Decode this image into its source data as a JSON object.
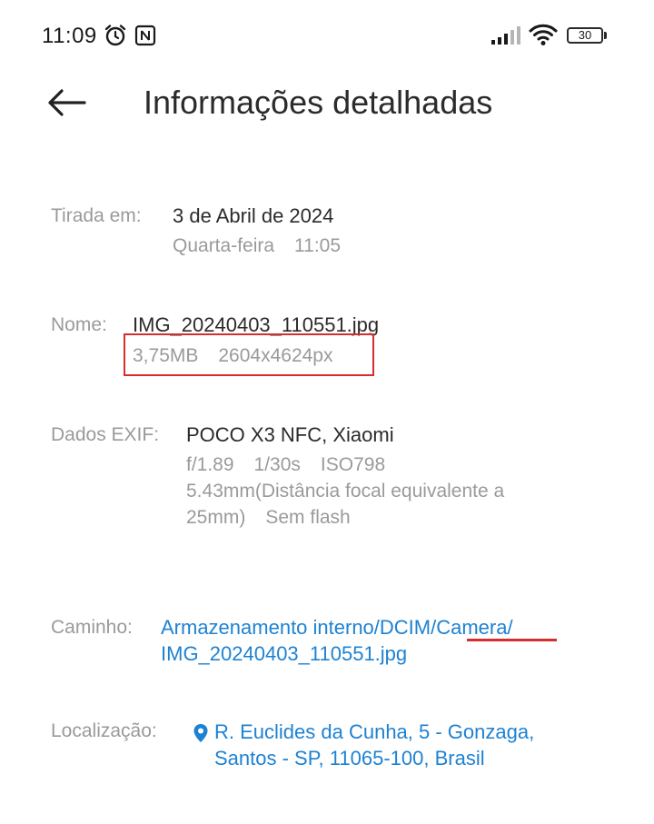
{
  "status_bar": {
    "time": "11:09",
    "battery": "30",
    "icons": [
      "alarm-icon",
      "nfc-icon",
      "signal-icon",
      "wifi-icon",
      "battery-icon"
    ]
  },
  "header": {
    "title": "Informações detalhadas",
    "back_icon": "arrow-left-icon"
  },
  "taken": {
    "label": "Tirada em:",
    "date": "3 de Abril de 2024",
    "weekday": "Quarta-feira",
    "time": "11:05"
  },
  "name": {
    "label": "Nome:",
    "filename": "IMG_20240403_110551.jpg",
    "size": "3,75MB",
    "resolution": "2604x4624px"
  },
  "exif": {
    "label": "Dados EXIF:",
    "device": "POCO X3 NFC, Xiaomi",
    "aperture": "f/1.89",
    "shutter": "1/30s",
    "iso": "ISO798",
    "focal_line1": "5.43mm(Distância focal equivalente a",
    "focal_line2": "25mm)",
    "flash": "Sem flash"
  },
  "path": {
    "label": "Caminho:",
    "line1": "Armazenamento interno/DCIM/Camera/",
    "line2": "IMG_20240403_110551.jpg"
  },
  "location": {
    "label": "Localização:",
    "icon": "location-pin-icon",
    "line1": "R. Euclides da Cunha, 5 - Gonzaga,",
    "line2": "Santos - SP, 11065-100, Brasil"
  },
  "colors": {
    "link": "#1e82d2",
    "label": "#9a9a9a",
    "text": "#2b2b2b",
    "annotation": "#d32f2f"
  }
}
